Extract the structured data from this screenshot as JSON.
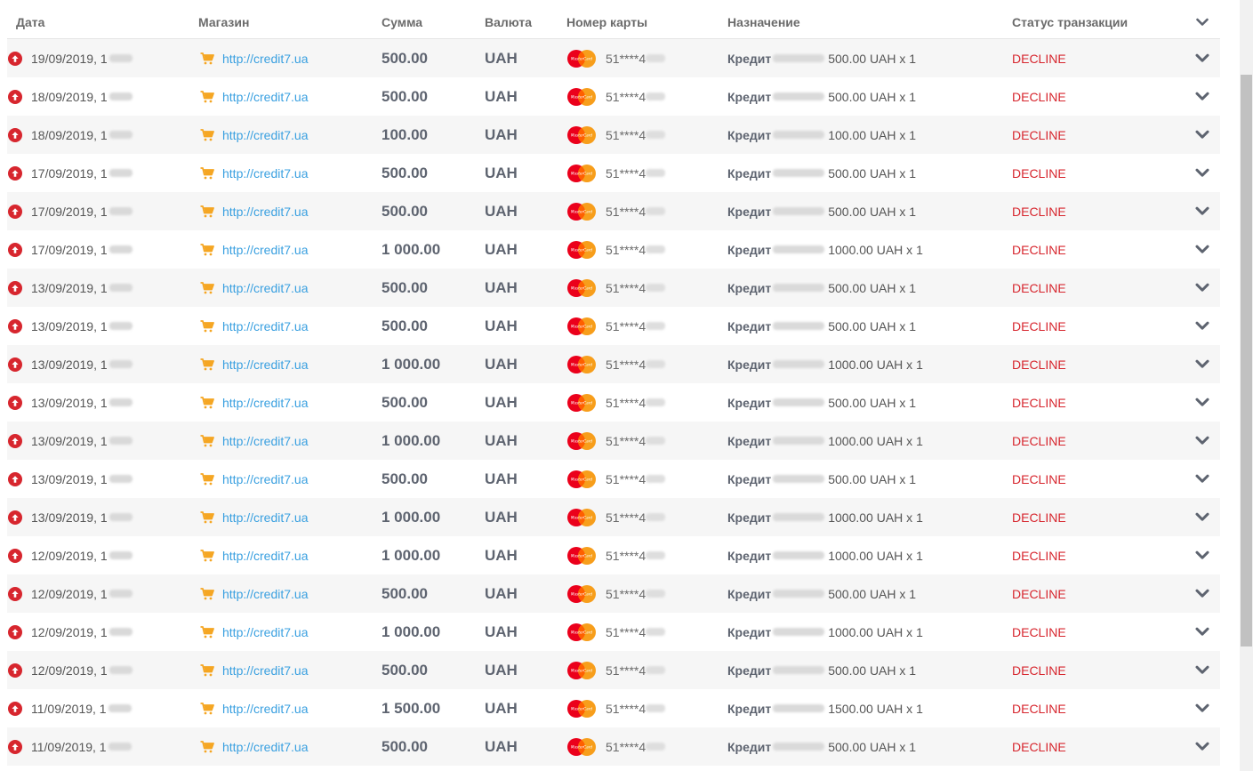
{
  "columns": {
    "date": "Дата",
    "shop": "Магазин",
    "sum": "Сумма",
    "currency": "Валюта",
    "card": "Номер карты",
    "purpose": "Назначение",
    "status": "Статус транзакции"
  },
  "colors": {
    "accent_link": "#3aa0e0",
    "decline_red": "#d7262e",
    "cart_orange": "#f5a623",
    "row_stripe": "#f6f6f6"
  },
  "icons": {
    "direction": "arrow-up-circle-icon",
    "shop": "shopping-cart-icon",
    "card_brand": "mastercard-logo",
    "expand": "chevron-down-icon"
  },
  "rows": [
    {
      "date": "19/09/2019, 1",
      "shop": "http://credit7.ua",
      "sum": "500.00",
      "currency": "UAH",
      "card": "51****4",
      "purpose_label": "Кредит",
      "purpose_amount": "500.00 UAH x 1",
      "status": "DECLINE"
    },
    {
      "date": "18/09/2019, 1",
      "shop": "http://credit7.ua",
      "sum": "500.00",
      "currency": "UAH",
      "card": "51****4",
      "purpose_label": "Кредит",
      "purpose_amount": "500.00 UAH x 1",
      "status": "DECLINE"
    },
    {
      "date": "18/09/2019, 1",
      "shop": "http://credit7.ua",
      "sum": "100.00",
      "currency": "UAH",
      "card": "51****4",
      "purpose_label": "Кредит",
      "purpose_amount": "100.00 UAH x 1",
      "status": "DECLINE"
    },
    {
      "date": "17/09/2019, 1",
      "shop": "http://credit7.ua",
      "sum": "500.00",
      "currency": "UAH",
      "card": "51****4",
      "purpose_label": "Кредит",
      "purpose_amount": "500.00 UAH x 1",
      "status": "DECLINE"
    },
    {
      "date": "17/09/2019, 1",
      "shop": "http://credit7.ua",
      "sum": "500.00",
      "currency": "UAH",
      "card": "51****4",
      "purpose_label": "Кредит",
      "purpose_amount": "500.00 UAH x 1",
      "status": "DECLINE"
    },
    {
      "date": "17/09/2019, 1",
      "shop": "http://credit7.ua",
      "sum": "1 000.00",
      "currency": "UAH",
      "card": "51****4",
      "purpose_label": "Кредит",
      "purpose_amount": "1000.00 UAH x 1",
      "status": "DECLINE"
    },
    {
      "date": "13/09/2019, 1",
      "shop": "http://credit7.ua",
      "sum": "500.00",
      "currency": "UAH",
      "card": "51****4",
      "purpose_label": "Кредит",
      "purpose_amount": "500.00 UAH x 1",
      "status": "DECLINE"
    },
    {
      "date": "13/09/2019, 1",
      "shop": "http://credit7.ua",
      "sum": "500.00",
      "currency": "UAH",
      "card": "51****4",
      "purpose_label": "Кредит",
      "purpose_amount": "500.00 UAH x 1",
      "status": "DECLINE"
    },
    {
      "date": "13/09/2019, 1",
      "shop": "http://credit7.ua",
      "sum": "1 000.00",
      "currency": "UAH",
      "card": "51****4",
      "purpose_label": "Кредит",
      "purpose_amount": "1000.00 UAH x 1",
      "status": "DECLINE"
    },
    {
      "date": "13/09/2019, 1",
      "shop": "http://credit7.ua",
      "sum": "500.00",
      "currency": "UAH",
      "card": "51****4",
      "purpose_label": "Кредит",
      "purpose_amount": "500.00 UAH x 1",
      "status": "DECLINE"
    },
    {
      "date": "13/09/2019, 1",
      "shop": "http://credit7.ua",
      "sum": "1 000.00",
      "currency": "UAH",
      "card": "51****4",
      "purpose_label": "Кредит",
      "purpose_amount": "1000.00 UAH x 1",
      "status": "DECLINE"
    },
    {
      "date": "13/09/2019, 1",
      "shop": "http://credit7.ua",
      "sum": "500.00",
      "currency": "UAH",
      "card": "51****4",
      "purpose_label": "Кредит",
      "purpose_amount": "500.00 UAH x 1",
      "status": "DECLINE"
    },
    {
      "date": "13/09/2019, 1",
      "shop": "http://credit7.ua",
      "sum": "1 000.00",
      "currency": "UAH",
      "card": "51****4",
      "purpose_label": "Кредит",
      "purpose_amount": "1000.00 UAH x 1",
      "status": "DECLINE"
    },
    {
      "date": "12/09/2019, 1",
      "shop": "http://credit7.ua",
      "sum": "1 000.00",
      "currency": "UAH",
      "card": "51****4",
      "purpose_label": "Кредит",
      "purpose_amount": "1000.00 UAH x 1",
      "status": "DECLINE"
    },
    {
      "date": "12/09/2019, 1",
      "shop": "http://credit7.ua",
      "sum": "500.00",
      "currency": "UAH",
      "card": "51****4",
      "purpose_label": "Кредит",
      "purpose_amount": "500.00 UAH x 1",
      "status": "DECLINE"
    },
    {
      "date": "12/09/2019, 1",
      "shop": "http://credit7.ua",
      "sum": "1 000.00",
      "currency": "UAH",
      "card": "51****4",
      "purpose_label": "Кредит",
      "purpose_amount": "1000.00 UAH x 1",
      "status": "DECLINE"
    },
    {
      "date": "12/09/2019, 1",
      "shop": "http://credit7.ua",
      "sum": "500.00",
      "currency": "UAH",
      "card": "51****4",
      "purpose_label": "Кредит",
      "purpose_amount": "500.00 UAH x 1",
      "status": "DECLINE"
    },
    {
      "date": "11/09/2019, 1",
      "shop": "http://credit7.ua",
      "sum": "1 500.00",
      "currency": "UAH",
      "card": "51****4",
      "purpose_label": "Кредит",
      "purpose_amount": "1500.00 UAH x 1",
      "status": "DECLINE"
    },
    {
      "date": "11/09/2019, 1",
      "shop": "http://credit7.ua",
      "sum": "500.00",
      "currency": "UAH",
      "card": "51****4",
      "purpose_label": "Кредит",
      "purpose_amount": "500.00 UAH x 1",
      "status": "DECLINE"
    }
  ]
}
